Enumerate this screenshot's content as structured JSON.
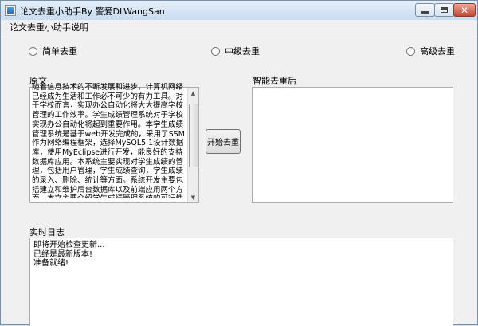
{
  "window": {
    "title": "论文去重小助手By 警爱DLWangSan"
  },
  "menu": {
    "items": [
      "论文去重小助手",
      "说明"
    ]
  },
  "modes": {
    "options": [
      "简单去重",
      "中级去重",
      "高级去重"
    ],
    "selected": null
  },
  "source": {
    "label": "原文",
    "text": "随着信息技术的不断发展和进步，计算机网络已经成为生活和工作必不可少的有力工具。对于学校而言，实现办公自动化将大大提高学校管理的工作效率。学生成绩管理系统对于学校实现办公自动化将起到重要作用。本学生成绩管理系统是基于web开发完成的，采用了SSM作为网络编程框架，选择MySQL5.1设计数据库，使用MyEclipse进行开发，能良好的支持数据库应用。本系统主要实现对学生成绩的管理，包括用户管理，学生成绩查询，学生成绩的录入、删除、统计等方面。系统开发主要包括建立和维护后台数据库以及前端应用两个方面。本文主要介绍学生成绩管理系统的可行性分析、需求分析、系统设计和系统实现等。"
  },
  "result": {
    "label": "智能去重后",
    "text": ""
  },
  "action": {
    "start_label": "开始去重"
  },
  "log": {
    "label": "实时日志",
    "lines": "即将开始检查更新...\n已经是最新版本!\n准备就绪!"
  }
}
